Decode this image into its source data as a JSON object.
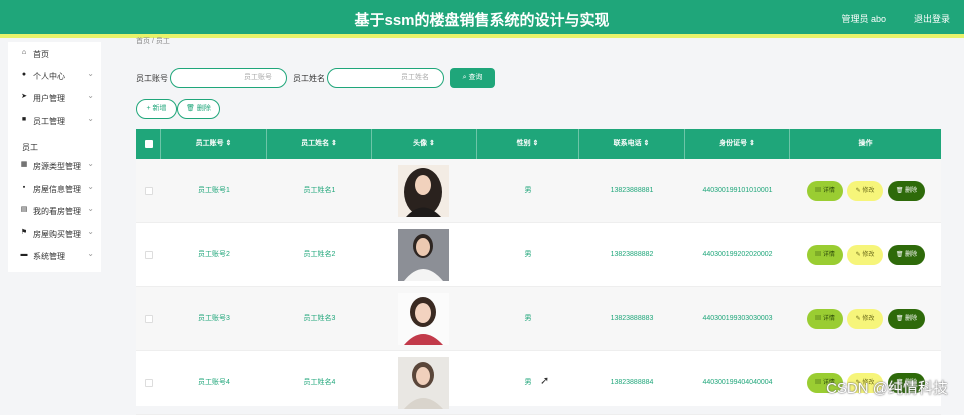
{
  "header": {
    "title": "基于ssm的楼盘销售系统的设计与实现",
    "admin_label": "管理员 abo",
    "logout_label": "退出登录"
  },
  "sidebar": {
    "items": [
      {
        "label": "首页",
        "icon": "home-icon",
        "glyph": "⌂",
        "has_chevron": false
      },
      {
        "label": "个人中心",
        "icon": "user-icon",
        "glyph": "●",
        "has_chevron": true
      },
      {
        "label": "用户管理",
        "icon": "send-icon",
        "glyph": "➤",
        "has_chevron": true
      },
      {
        "label": "员工管理",
        "icon": "book-icon",
        "glyph": "■",
        "has_chevron": true
      },
      {
        "label": "员工",
        "icon": "",
        "glyph": "",
        "has_chevron": false,
        "sub": true
      },
      {
        "label": "房源类型管理",
        "icon": "grid-icon",
        "glyph": "▦",
        "has_chevron": true
      },
      {
        "label": "房屋信息管理",
        "icon": "apps-icon",
        "glyph": "▪",
        "has_chevron": true
      },
      {
        "label": "我的看房管理",
        "icon": "doc-icon",
        "glyph": "▤",
        "has_chevron": true
      },
      {
        "label": "房屋购买管理",
        "icon": "flag-icon",
        "glyph": "⚑",
        "has_chevron": true
      },
      {
        "label": "系统管理",
        "icon": "monitor-icon",
        "glyph": "▬",
        "has_chevron": true
      }
    ]
  },
  "breadcrumb": "首页 / 员工",
  "search": {
    "label1": "员工账号",
    "placeholder1": "员工账号",
    "label2": "员工姓名",
    "placeholder2": "员工姓名",
    "button": "查询"
  },
  "actions": {
    "add": "+ 新增",
    "delete": "删除"
  },
  "table": {
    "headers": [
      "员工账号",
      "员工姓名",
      "头像",
      "性别",
      "联系电话",
      "身份证号",
      "操作"
    ],
    "rows": [
      {
        "account": "员工账号1",
        "name": "员工姓名1",
        "gender": "男",
        "phone": "13823888881",
        "id": "440300199101010001"
      },
      {
        "account": "员工账号2",
        "name": "员工姓名2",
        "gender": "男",
        "phone": "13823888882",
        "id": "440300199202020002"
      },
      {
        "account": "员工账号3",
        "name": "员工姓名3",
        "gender": "男",
        "phone": "13823888883",
        "id": "440300199303030003"
      },
      {
        "account": "员工账号4",
        "name": "员工姓名4",
        "gender": "男",
        "phone": "13823888884",
        "id": "440300199404040004"
      }
    ],
    "op_detail": "详情",
    "op_edit": "修改",
    "op_delete": "删除"
  },
  "watermark": "CSDN @纯情科技",
  "colors": {
    "primary": "#1fa67a",
    "accent_line": "#e8f26a",
    "detail": "#9acd32",
    "edit": "#f6f57a",
    "delete": "#2e6a0a"
  }
}
